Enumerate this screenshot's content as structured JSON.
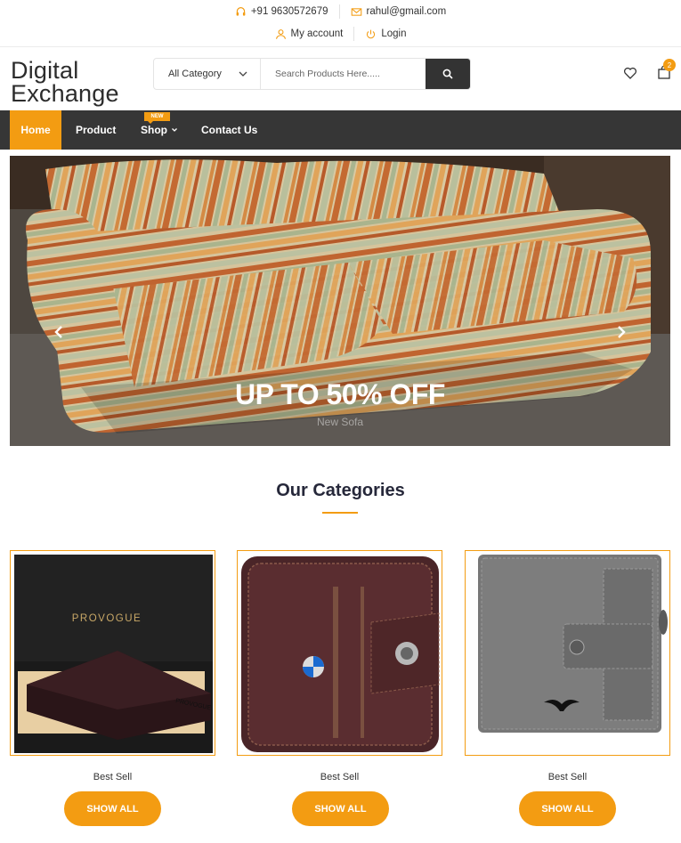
{
  "topbar": {
    "phone": "+91 9630572679",
    "email": "rahul@gmail.com",
    "account": "My account",
    "login": "Login"
  },
  "header": {
    "logo_line1": "Digital",
    "logo_line2": "Exchange",
    "category": "All Category",
    "search_placeholder": "Search Products Here.....",
    "cart_count": "2"
  },
  "nav": {
    "items": [
      {
        "label": "Home"
      },
      {
        "label": "Product"
      },
      {
        "label": "Shop"
      },
      {
        "label": "Contact Us"
      }
    ],
    "new_badge": "NEW"
  },
  "hero": {
    "title": "UP TO 50% OFF",
    "subtitle": "New Sofa"
  },
  "categories": {
    "title": "Our Categories",
    "items": [
      {
        "label": "Best Sell",
        "button": "SHOW ALL",
        "brand": "PROVOGUE"
      },
      {
        "label": "Best Sell",
        "button": "SHOW ALL"
      },
      {
        "label": "Best Sell",
        "button": "SHOW ALL"
      }
    ]
  },
  "colors": {
    "accent": "#f39c12",
    "nav_bg": "#363636",
    "dark": "#333333"
  }
}
